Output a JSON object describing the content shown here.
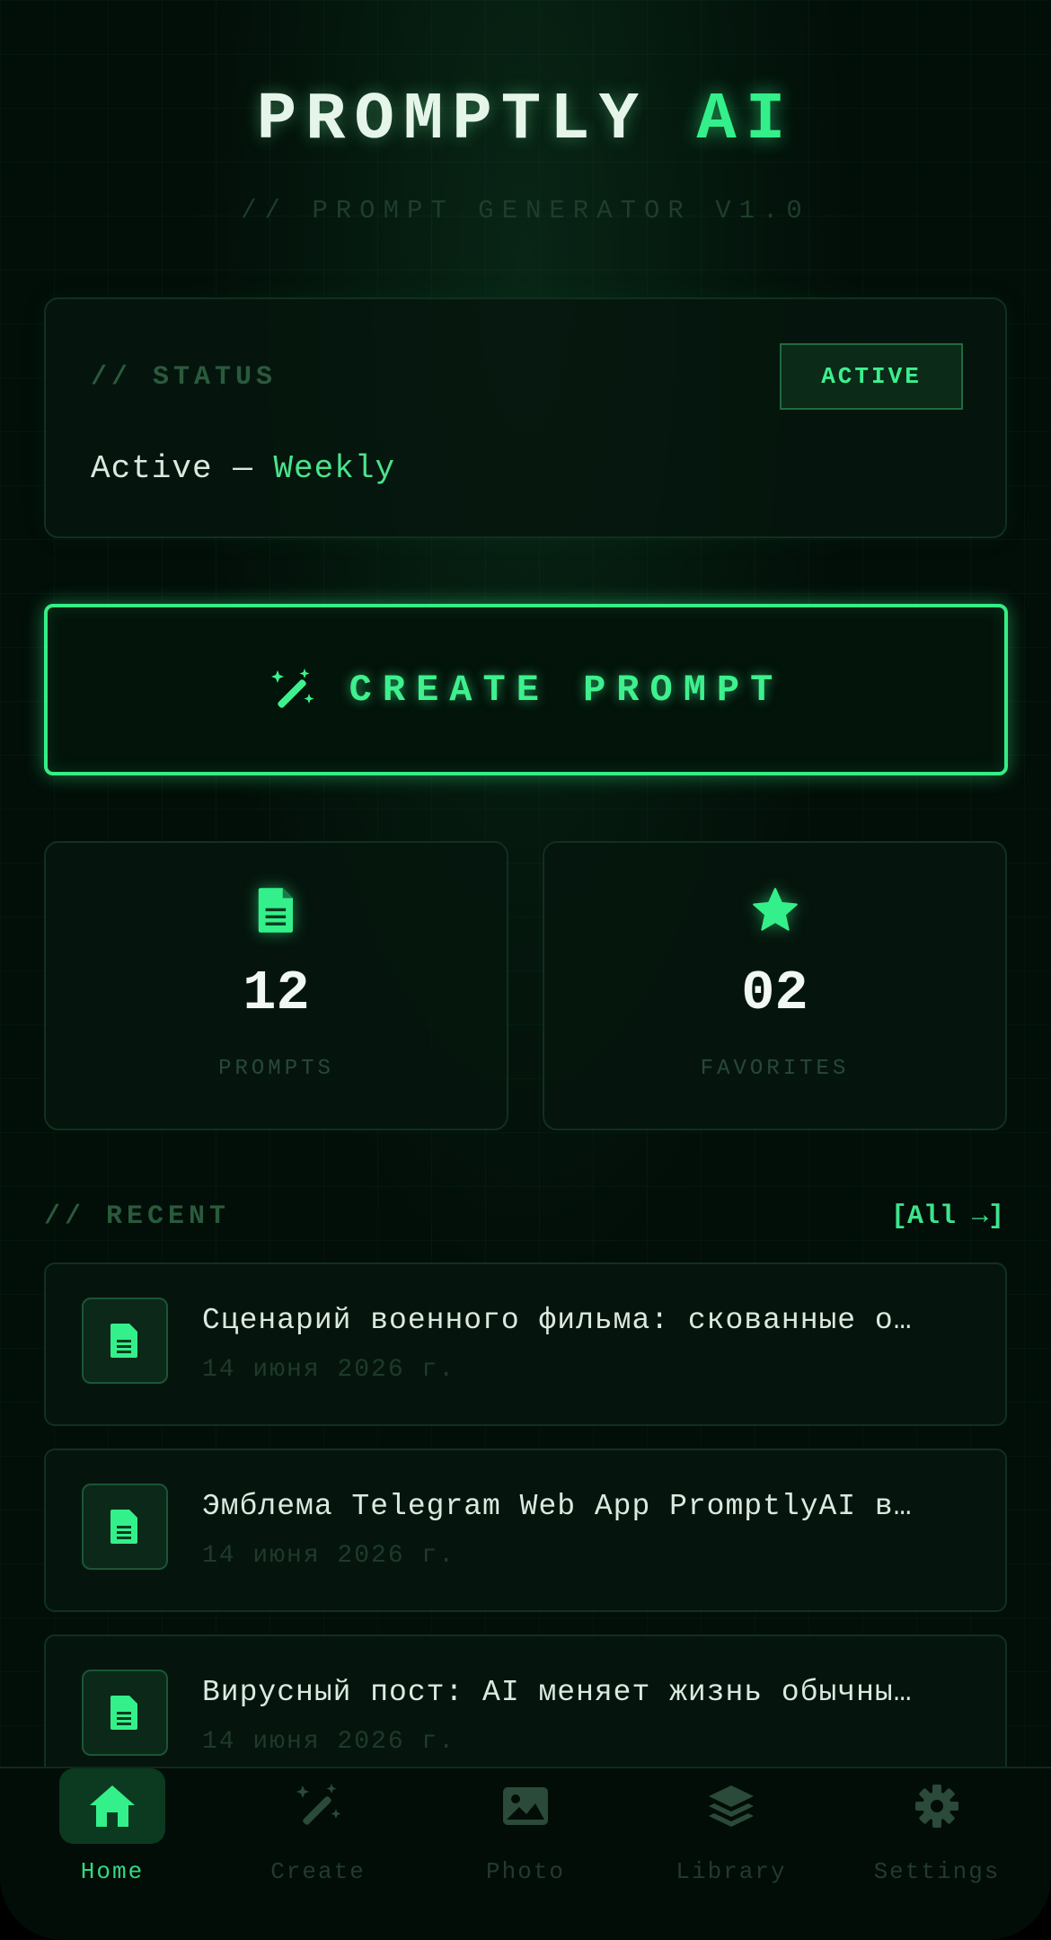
{
  "header": {
    "title_main": "PROMPTLY",
    "title_accent": "AI",
    "subtitle": "// PROMPT GENERATOR V1.0"
  },
  "status": {
    "label": "// STATUS",
    "badge": "ACTIVE",
    "state": "Active —",
    "period": "Weekly"
  },
  "create_button": {
    "label": "CREATE PROMPT",
    "icon": "magic-wand-icon"
  },
  "stats": [
    {
      "icon": "document-icon",
      "value": "12",
      "label": "PROMPTS"
    },
    {
      "icon": "star-icon",
      "value": "02",
      "label": "FAVORITES"
    }
  ],
  "recent": {
    "title": "// RECENT",
    "all_link": "[All →]",
    "items": [
      {
        "title": "Сценарий военного фильма: скованные о…",
        "date": "14 июня 2026 г."
      },
      {
        "title": "Эмблема Telegram Web App PromptlyAI в…",
        "date": "14 июня 2026 г."
      },
      {
        "title": "Вирусный пост: AI меняет жизнь обычны…",
        "date": "14 июня 2026 г."
      }
    ]
  },
  "nav": [
    {
      "label": "Home",
      "icon": "home-icon",
      "active": true
    },
    {
      "label": "Create",
      "icon": "magic-wand-icon",
      "active": false
    },
    {
      "label": "Photo",
      "icon": "image-icon",
      "active": false
    },
    {
      "label": "Library",
      "icon": "layers-icon",
      "active": false
    },
    {
      "label": "Settings",
      "icon": "gear-icon",
      "active": false
    }
  ],
  "colors": {
    "accent": "#34f08a",
    "background": "#020e08",
    "muted": "#2a5a3c"
  }
}
